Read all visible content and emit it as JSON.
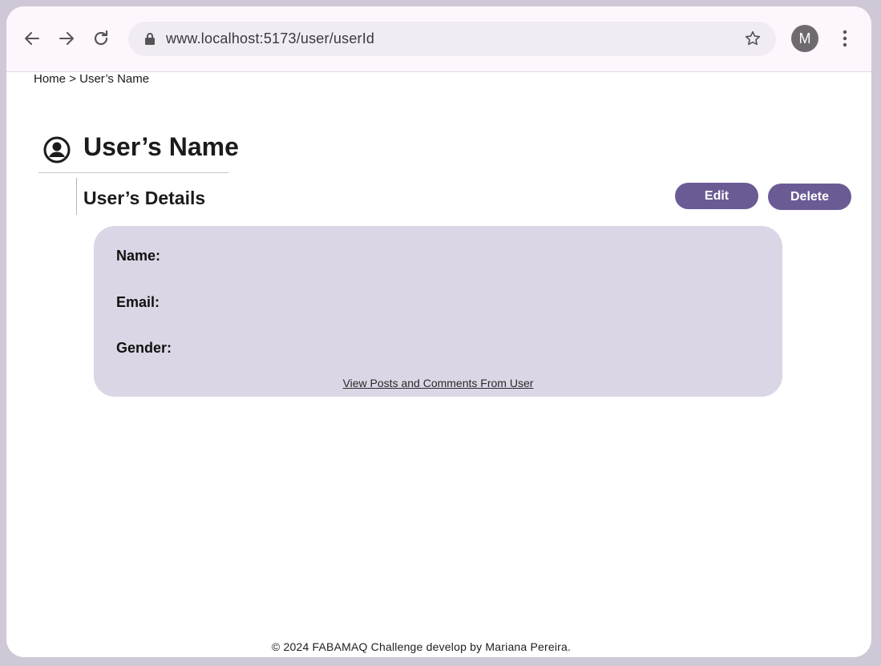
{
  "browser": {
    "url": "www.localhost:5173/user/userId",
    "profile_initial": "M"
  },
  "breadcrumb": {
    "home": "Home",
    "separator": ">",
    "current": "User’s Name"
  },
  "page": {
    "title": "User’s Name",
    "section_title": "User’s Details"
  },
  "actions": {
    "edit_label": "Edit",
    "delete_label": "Delete"
  },
  "details": {
    "fields": [
      {
        "label": "Name:",
        "value": ""
      },
      {
        "label": "Email:",
        "value": ""
      },
      {
        "label": "Gender:",
        "value": ""
      }
    ],
    "link_label": "View Posts and Comments From User"
  },
  "footer": {
    "text": "© 2024 FABAMAQ Challenge develop by Mariana Pereira."
  },
  "colors": {
    "accent": "#6b5b95",
    "card_bg": "#dbd6e5",
    "chrome_bg": "#fdf6fd"
  }
}
